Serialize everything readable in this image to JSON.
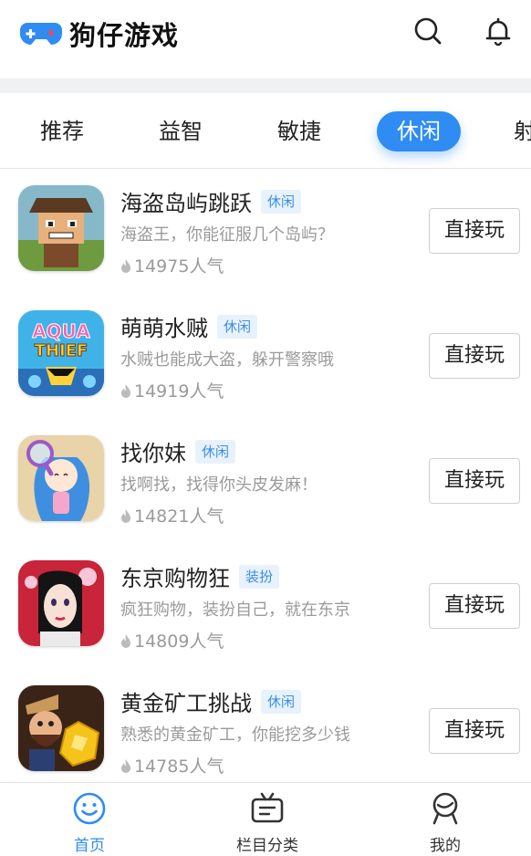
{
  "app": {
    "title": "狗仔游戏"
  },
  "header": {
    "search_icon": "search-icon",
    "bell_icon": "bell-icon"
  },
  "tabs": [
    {
      "label": "推荐",
      "active": false
    },
    {
      "label": "益智",
      "active": false
    },
    {
      "label": "敏捷",
      "active": false
    },
    {
      "label": "休闲",
      "active": true
    },
    {
      "label": "射",
      "active": false
    }
  ],
  "games": [
    {
      "title": "海盗岛屿跳跃",
      "tag": "休闲",
      "desc": "海盗王，你能征服几个岛屿？",
      "popularity": "14975人气",
      "button": "直接玩"
    },
    {
      "title": "萌萌水贼",
      "tag": "休闲",
      "desc": "水贼也能成大盗，躲开警察哦",
      "popularity": "14919人气",
      "button": "直接玩"
    },
    {
      "title": "找你妹",
      "tag": "休闲",
      "desc": "找啊找，找得你头皮发麻！",
      "popularity": "14821人气",
      "button": "直接玩"
    },
    {
      "title": "东京购物狂",
      "tag": "装扮",
      "desc": "疯狂购物，装扮自己，就在东京",
      "popularity": "14809人气",
      "button": "直接玩"
    },
    {
      "title": "黄金矿工挑战",
      "tag": "休闲",
      "desc": "熟悉的黄金矿工，你能挖多少钱",
      "popularity": "14785人气",
      "button": "直接玩"
    }
  ],
  "thumb_text": {
    "aqua": "AQUA",
    "thief": "THIEF"
  },
  "nav": [
    {
      "label": "首页",
      "icon": "smiley-icon",
      "active": true
    },
    {
      "label": "栏目分类",
      "icon": "category-icon",
      "active": false
    },
    {
      "label": "我的",
      "icon": "user-icon",
      "active": false
    }
  ],
  "colors": {
    "accent": "#2f8cf3",
    "tag_bg": "#e8f2fd",
    "tag_text": "#3a8ee6"
  }
}
